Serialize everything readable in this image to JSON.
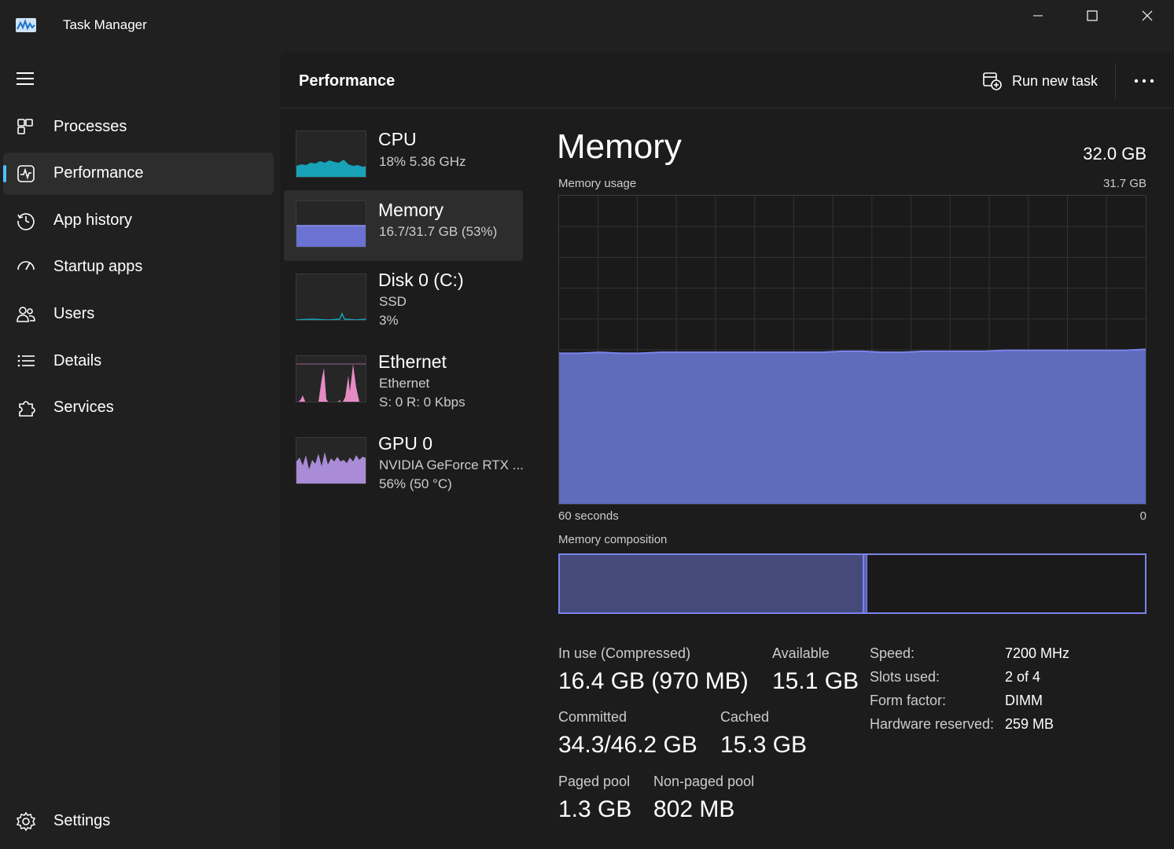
{
  "window": {
    "title": "Task Manager",
    "minimize_icon": "minimize-icon",
    "maximize_icon": "maximize-icon",
    "close_icon": "close-icon"
  },
  "nav": {
    "menu_icon": "hamburger-menu-icon",
    "items": [
      {
        "label": "Processes",
        "icon": "processes-grid-icon",
        "active": false
      },
      {
        "label": "Performance",
        "icon": "performance-pulse-icon",
        "active": true
      },
      {
        "label": "App history",
        "icon": "history-clock-icon",
        "active": false
      },
      {
        "label": "Startup apps",
        "icon": "startup-speedometer-icon",
        "active": false
      },
      {
        "label": "Users",
        "icon": "users-icon",
        "active": false
      },
      {
        "label": "Details",
        "icon": "details-list-icon",
        "active": false
      },
      {
        "label": "Services",
        "icon": "services-puzzle-icon",
        "active": false
      }
    ],
    "settings": {
      "label": "Settings",
      "icon": "gear-icon"
    }
  },
  "header": {
    "title": "Performance",
    "run_new_task": "Run new task",
    "more_icon": "more-ellipsis-icon"
  },
  "devices": [
    {
      "name": "CPU",
      "lines": [
        "18%  5.36 GHz"
      ],
      "color": "#17a2b8",
      "active": false
    },
    {
      "name": "Memory",
      "lines": [
        "16.7/31.7 GB (53%)"
      ],
      "color": "#7b83eb",
      "active": true
    },
    {
      "name": "Disk 0 (C:)",
      "lines": [
        "SSD",
        "3%"
      ],
      "color": "#17a2b8",
      "active": false
    },
    {
      "name": "Ethernet",
      "lines": [
        "Ethernet",
        "S: 0  R: 0 Kbps"
      ],
      "color": "#e58bc4",
      "active": false
    },
    {
      "name": "GPU 0",
      "lines": [
        "NVIDIA GeForce RTX ...",
        "56%  (50 °C)"
      ],
      "color": "#a98bd6",
      "active": false
    }
  ],
  "detail": {
    "title": "Memory",
    "total": "32.0 GB",
    "usage_label": "Memory usage",
    "usage_max": "31.7 GB",
    "time_left": "60 seconds",
    "time_right": "0",
    "composition_label": "Memory composition",
    "accent": "#7b83eb",
    "fill": "#5f6bbb"
  },
  "chart_data": {
    "type": "area",
    "title": "Memory usage",
    "ylim": [
      0,
      31.7
    ],
    "xlabel": "60 seconds",
    "grid": true,
    "series": [
      {
        "values": [
          15.5,
          15.5,
          15.6,
          15.5,
          15.5,
          15.6,
          15.6,
          15.6,
          15.6,
          15.6,
          15.6,
          15.6,
          15.6,
          15.6,
          15.7,
          15.7,
          15.6,
          15.6,
          15.7,
          15.7,
          15.7,
          15.7,
          15.8,
          15.8,
          15.8,
          15.8,
          15.8,
          15.8,
          15.8,
          15.9
        ]
      }
    ]
  },
  "composition": {
    "in_use_fraction": 0.52,
    "modified_fraction": 0.006
  },
  "stats": {
    "in_use_label": "In use (Compressed)",
    "in_use_value": "16.4 GB (970 MB)",
    "available_label": "Available",
    "available_value": "15.1 GB",
    "committed_label": "Committed",
    "committed_value": "34.3/46.2 GB",
    "cached_label": "Cached",
    "cached_value": "15.3 GB",
    "paged_label": "Paged pool",
    "paged_value": "1.3 GB",
    "nonpaged_label": "Non-paged pool",
    "nonpaged_value": "802 MB"
  },
  "props": [
    {
      "label": "Speed:",
      "value": "7200 MHz"
    },
    {
      "label": "Slots used:",
      "value": "2 of 4"
    },
    {
      "label": "Form factor:",
      "value": "DIMM"
    },
    {
      "label": "Hardware reserved:",
      "value": "259 MB"
    }
  ]
}
